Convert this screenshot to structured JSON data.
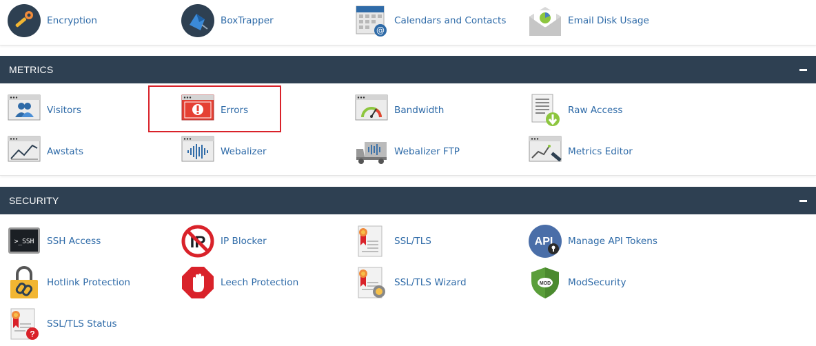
{
  "top_row": [
    {
      "label": "Encryption",
      "icon": "encryption-icon"
    },
    {
      "label": "BoxTrapper",
      "icon": "boxtrapper-icon"
    },
    {
      "label": "Calendars and Contacts",
      "icon": "calendars-icon"
    },
    {
      "label": "Email Disk Usage",
      "icon": "email-disk-usage-icon"
    }
  ],
  "metrics": {
    "title": "METRICS",
    "items": [
      {
        "label": "Visitors",
        "icon": "visitors-icon"
      },
      {
        "label": "Errors",
        "icon": "errors-icon"
      },
      {
        "label": "Bandwidth",
        "icon": "bandwidth-icon"
      },
      {
        "label": "Raw Access",
        "icon": "raw-access-icon"
      },
      {
        "label": "Awstats",
        "icon": "awstats-icon"
      },
      {
        "label": "Webalizer",
        "icon": "webalizer-icon"
      },
      {
        "label": "Webalizer FTP",
        "icon": "webalizer-ftp-icon"
      },
      {
        "label": "Metrics Editor",
        "icon": "metrics-editor-icon"
      }
    ]
  },
  "security": {
    "title": "SECURITY",
    "items": [
      {
        "label": "SSH Access",
        "icon": "ssh-icon",
        "icon_text": ">_SSH"
      },
      {
        "label": "IP Blocker",
        "icon": "ip-blocker-icon",
        "icon_text": "IP"
      },
      {
        "label": "SSL/TLS",
        "icon": "ssl-certificate-icon"
      },
      {
        "label": "Manage API Tokens",
        "icon": "api-token-icon",
        "icon_text": "API"
      },
      {
        "label": "Hotlink Protection",
        "icon": "padlock-chain-icon"
      },
      {
        "label": "Leech Protection",
        "icon": "stop-hand-icon"
      },
      {
        "label": "SSL/TLS Wizard",
        "icon": "ssl-wizard-icon"
      },
      {
        "label": "ModSecurity",
        "icon": "shield-icon",
        "icon_text": "MOD"
      },
      {
        "label": "SSL/TLS Status",
        "icon": "ssl-status-icon"
      }
    ]
  },
  "colors": {
    "header_bg": "#2e4052",
    "link": "#2f6ba8",
    "highlight": "#d9222a"
  }
}
